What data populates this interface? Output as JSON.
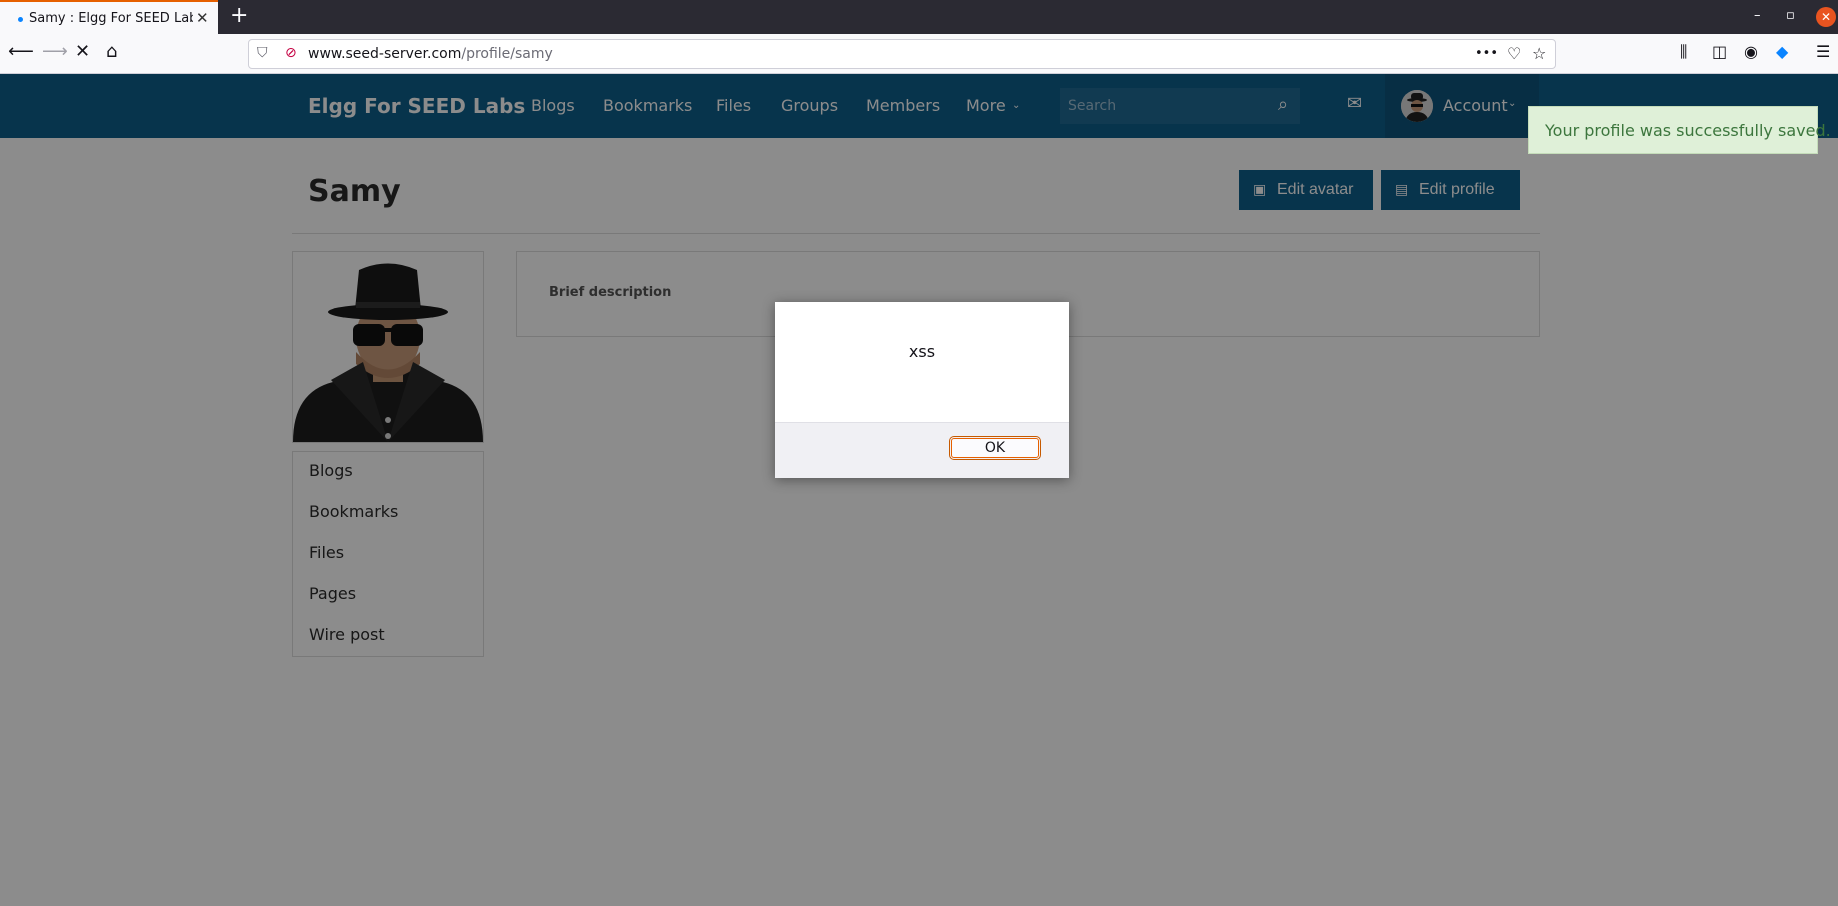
{
  "browser": {
    "tab_title": "Samy : Elgg For SEED Labs",
    "tab_close": "✕",
    "new_tab": "+",
    "url_host": "www.seed-server.com",
    "url_path": "/profile/samy",
    "url_more": "•••"
  },
  "site": {
    "brand": "Elgg For SEED Labs",
    "menu": [
      "Blogs",
      "Bookmarks",
      "Files",
      "Groups",
      "Members",
      "More"
    ],
    "search_placeholder": "Search",
    "account_label": "Account"
  },
  "profile": {
    "name": "Samy",
    "edit_avatar": "Edit avatar",
    "edit_profile": "Edit profile",
    "brief_description_label": "Brief description",
    "owner_menu": [
      "Blogs",
      "Bookmarks",
      "Files",
      "Pages",
      "Wire post"
    ]
  },
  "toast": {
    "message": "Your profile was successfully saved."
  },
  "alert": {
    "message": "xss",
    "ok_label": "OK"
  },
  "colors": {
    "header": "#0e5f8b",
    "button": "#0e5f8b",
    "toast_bg": "#dff0d8",
    "toast_text": "#3c763d",
    "tab_accent": "#e66000"
  }
}
